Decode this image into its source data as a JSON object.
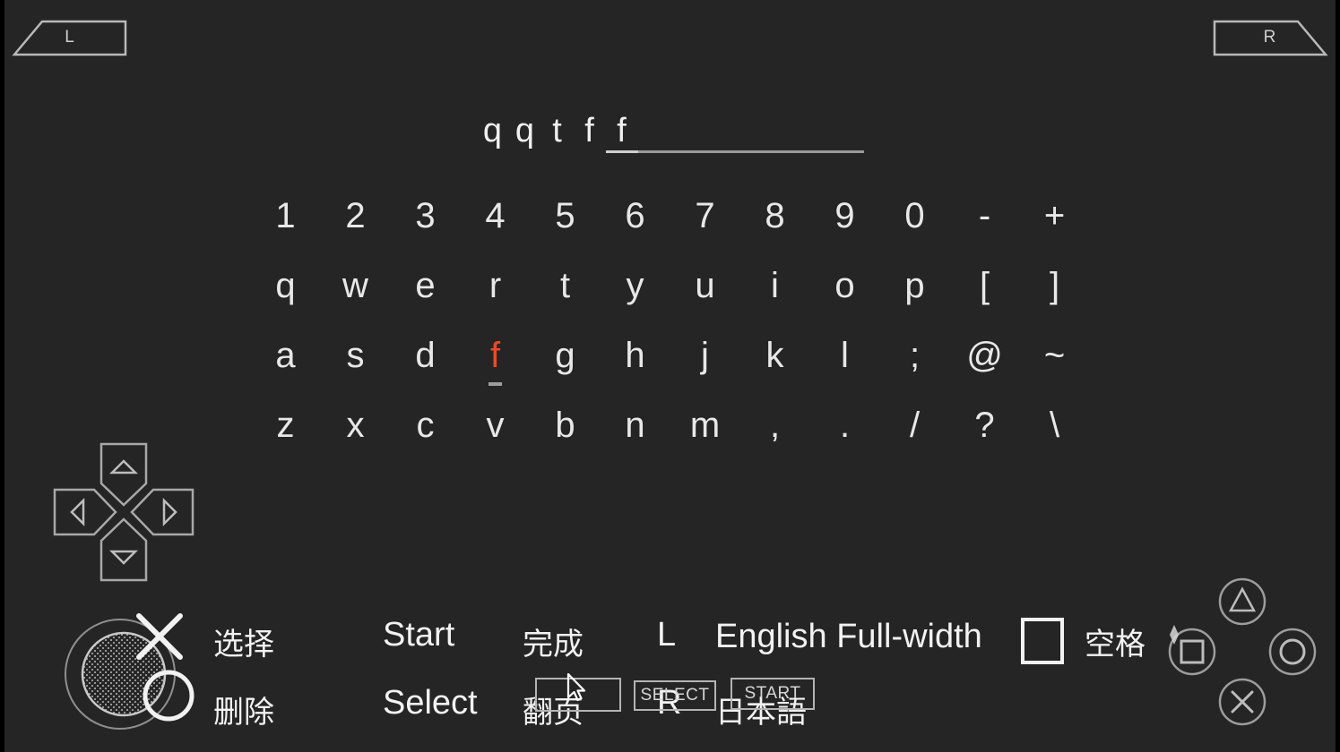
{
  "screen": {
    "background_color": "#252525",
    "border_color": "#000000"
  },
  "shoulders": {
    "left_label": "L",
    "right_label": "R"
  },
  "text_input": {
    "entered_text": "qqtff",
    "chars": [
      "q",
      "q",
      "t",
      "f",
      "f"
    ],
    "cursor_index": 4,
    "blank_slots": 7,
    "total_slots": 12
  },
  "keyboard": {
    "selected_key": "f",
    "selected_color": "#ea4b26",
    "key_color": "#e8e8e8",
    "rows": [
      [
        "1",
        "2",
        "3",
        "4",
        "5",
        "6",
        "7",
        "8",
        "9",
        "0",
        "-",
        "+"
      ],
      [
        "q",
        "w",
        "e",
        "r",
        "t",
        "y",
        "u",
        "i",
        "o",
        "p",
        "[",
        "]"
      ],
      [
        "a",
        "s",
        "d",
        "f",
        "g",
        "h",
        "j",
        "k",
        "l",
        ";",
        "@",
        "~"
      ],
      [
        "z",
        "x",
        "c",
        "v",
        "b",
        "n",
        "m",
        ",",
        ".",
        "/",
        "?",
        "\\"
      ]
    ]
  },
  "legend": {
    "cross_action": "选择",
    "circle_action": "删除",
    "start_label": "Start",
    "start_action": "完成",
    "select_label": "Select",
    "select_action": "翻页",
    "l_label": "L",
    "l_action": "English Full-width",
    "r_label": "R",
    "r_action": "日本語",
    "square_action": "空格"
  },
  "overlay_buttons": {
    "blank_label": "",
    "select_label": "SELECT",
    "start_label": "START"
  },
  "dpad": {
    "up_icon": "triangle-up-icon",
    "down_icon": "triangle-down-icon",
    "left_icon": "triangle-left-icon",
    "right_icon": "triangle-right-icon"
  },
  "face_buttons": {
    "triangle_icon": "triangle-button-icon",
    "circle_icon": "circle-button-icon",
    "square_icon": "square-button-icon",
    "cross_icon": "cross-button-icon"
  },
  "analog_stick": {
    "icon": "analog-stick-icon"
  },
  "cursor": {
    "icon": "mouse-pointer-icon"
  }
}
